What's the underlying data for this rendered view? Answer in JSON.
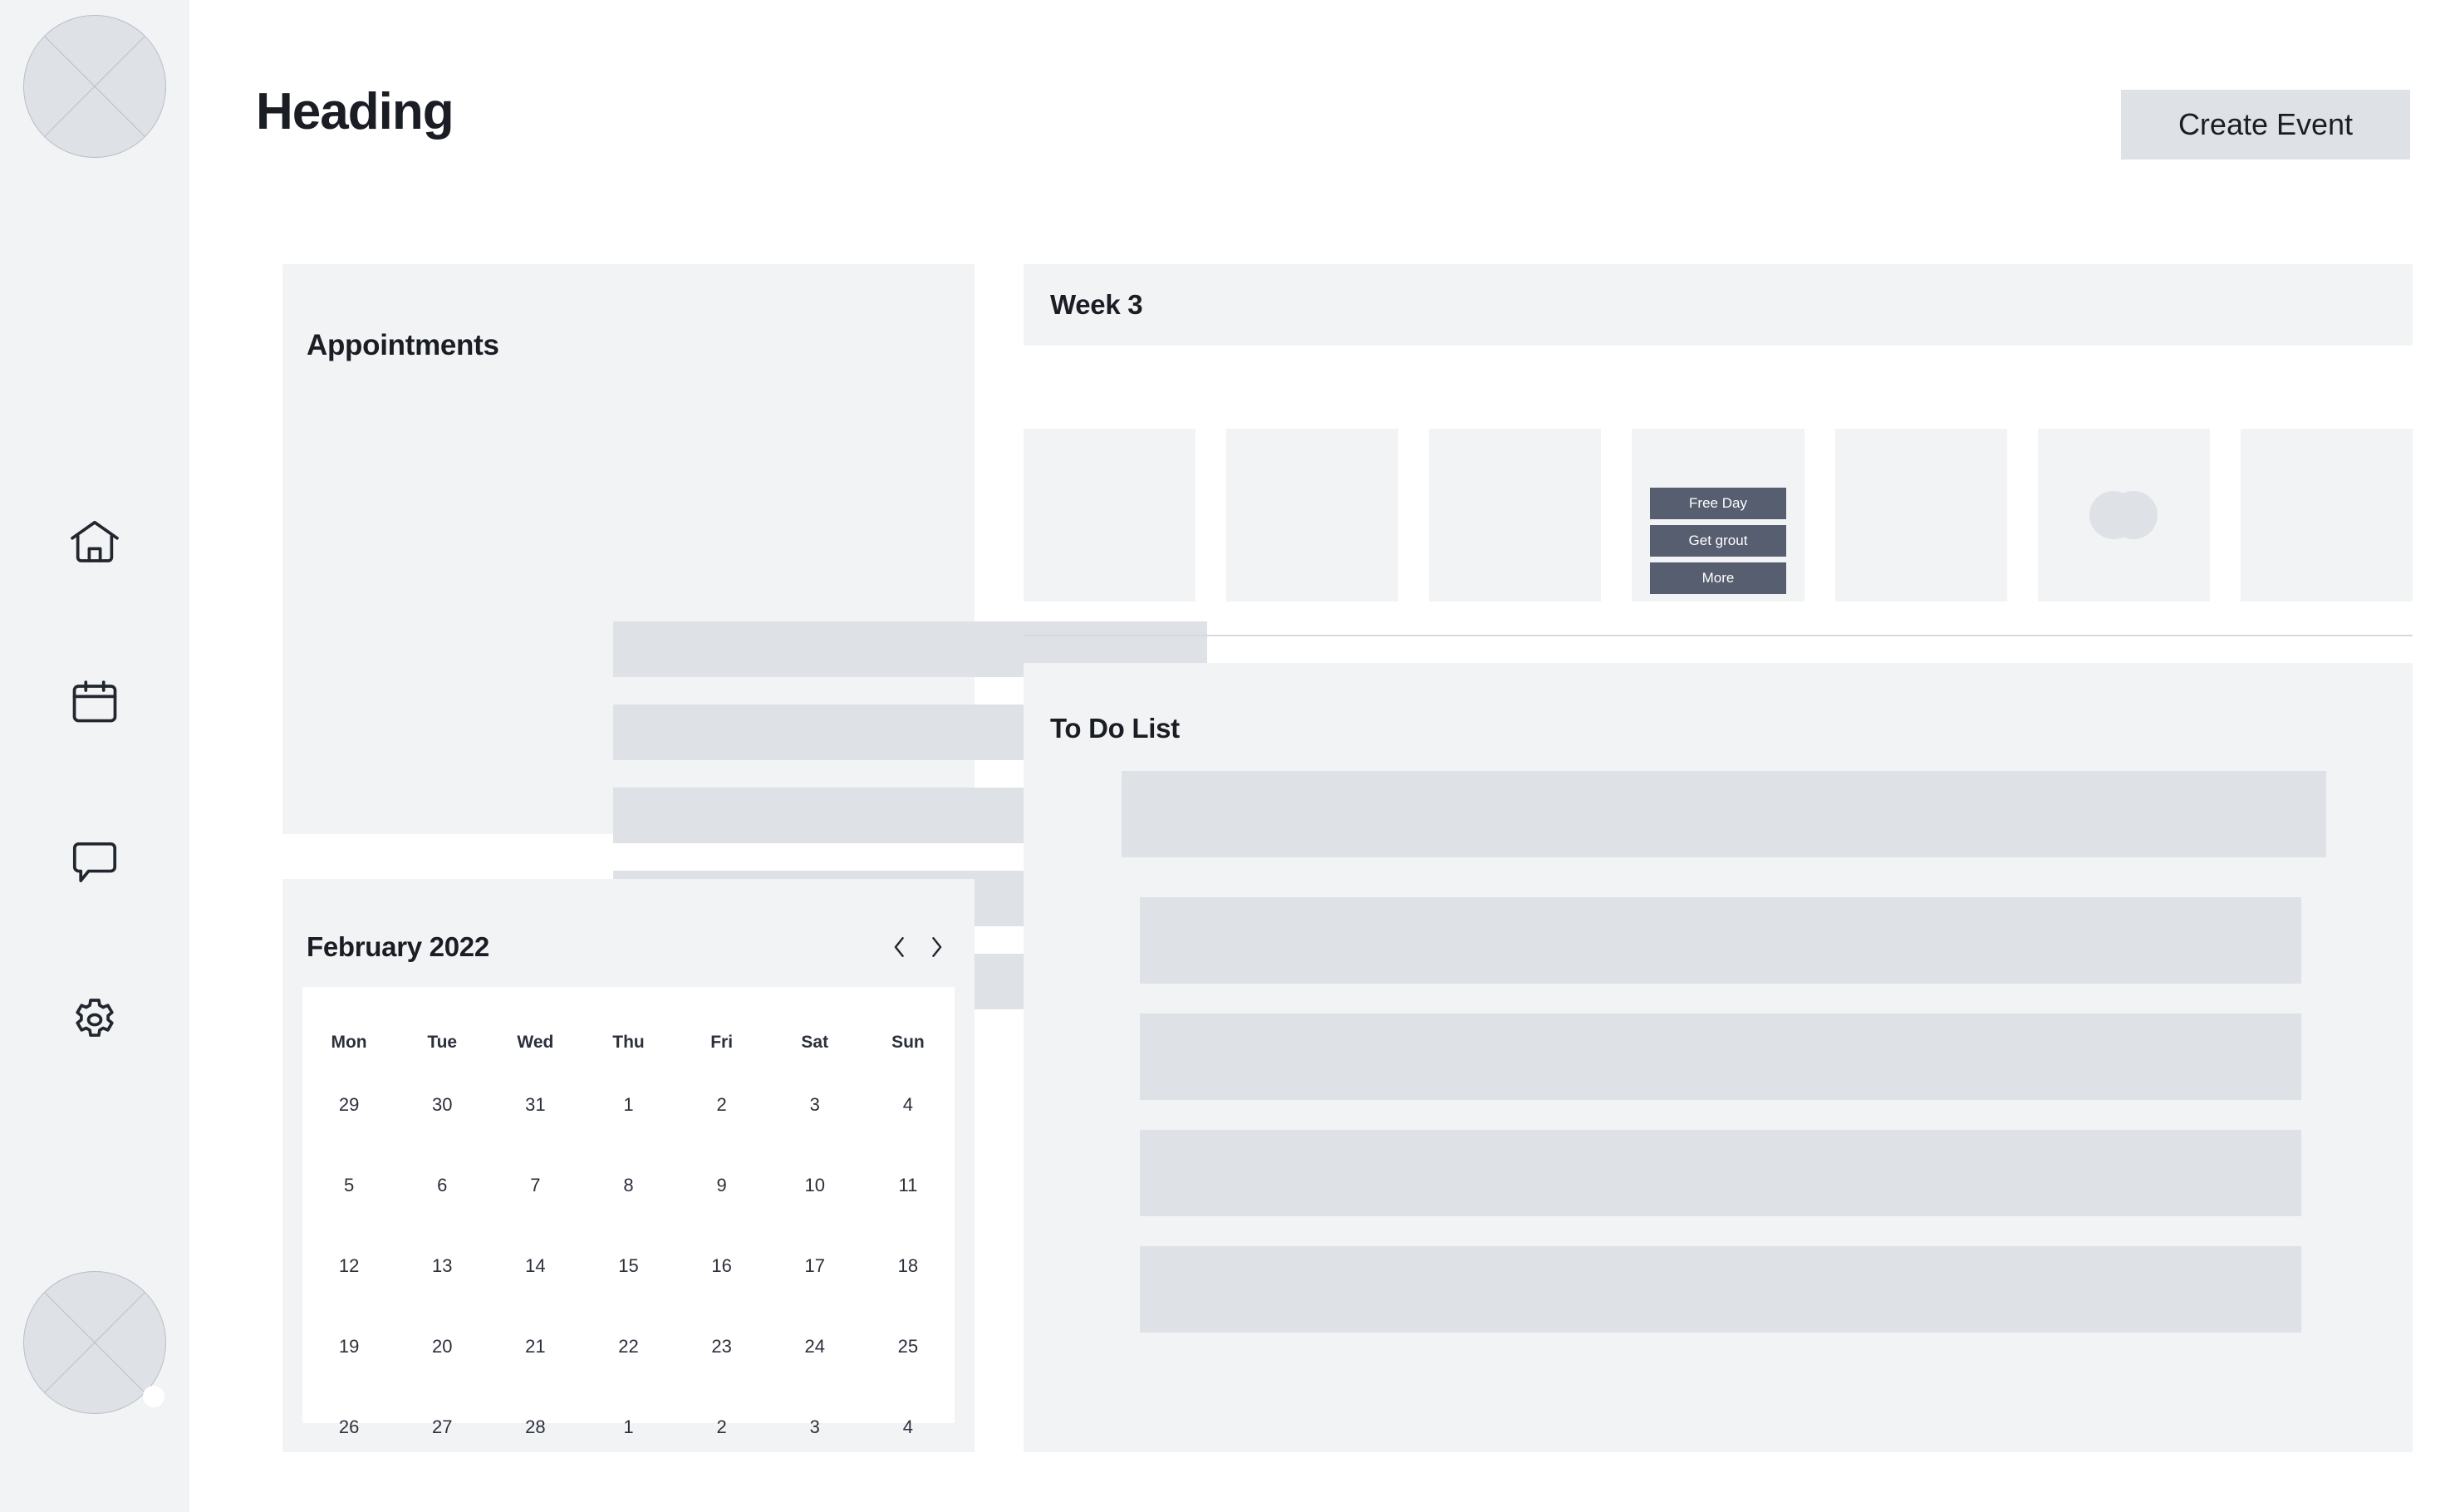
{
  "header": {
    "title": "Heading",
    "create_event_label": "Create Event"
  },
  "sidebar": {
    "avatar_top": {
      "icon": "image-placeholder-avatar"
    },
    "avatar_bottom": {
      "icon": "image-placeholder-avatar",
      "status": "online"
    },
    "items": [
      {
        "icon": "home-icon",
        "name": "home"
      },
      {
        "icon": "calendar-icon",
        "name": "calendar"
      },
      {
        "icon": "chat-bubble-icon",
        "name": "messages"
      },
      {
        "icon": "gear-icon",
        "name": "settings"
      }
    ]
  },
  "appointments": {
    "title": "Appointments",
    "items": [
      "",
      "",
      "",
      "",
      ""
    ]
  },
  "calendar": {
    "title": "February 2022",
    "prev_icon": "chevron-left-icon",
    "next_icon": "chevron-right-icon",
    "weekdays": [
      "Mon",
      "Tue",
      "Wed",
      "Thu",
      "Fri",
      "Sat",
      "Sun"
    ],
    "weeks": [
      [
        "29",
        "30",
        "31",
        "1",
        "2",
        "3",
        "4"
      ],
      [
        "5",
        "6",
        "7",
        "8",
        "9",
        "10",
        "11"
      ],
      [
        "12",
        "13",
        "14",
        "15",
        "16",
        "17",
        "18"
      ],
      [
        "19",
        "20",
        "21",
        "22",
        "23",
        "24",
        "25"
      ],
      [
        "26",
        "27",
        "28",
        "1",
        "2",
        "3",
        "4"
      ]
    ]
  },
  "week": {
    "title": "Week 3",
    "days": [
      {
        "events": []
      },
      {
        "events": []
      },
      {
        "events": []
      },
      {
        "events": [
          "Free Day",
          "Get grout",
          "More"
        ]
      },
      {
        "events": []
      },
      {
        "events": [],
        "shape": "blob"
      },
      {
        "events": []
      }
    ]
  },
  "todo": {
    "title": "To Do List",
    "items": [
      "",
      "",
      "",
      "",
      ""
    ]
  },
  "colors": {
    "panel_bg": "#f1f3f5",
    "placeholder": "#dee2e6",
    "event_chip": "#565e70",
    "text": "#1a1d24",
    "divider": "#d6dade",
    "page_bg": "#ffffff"
  }
}
